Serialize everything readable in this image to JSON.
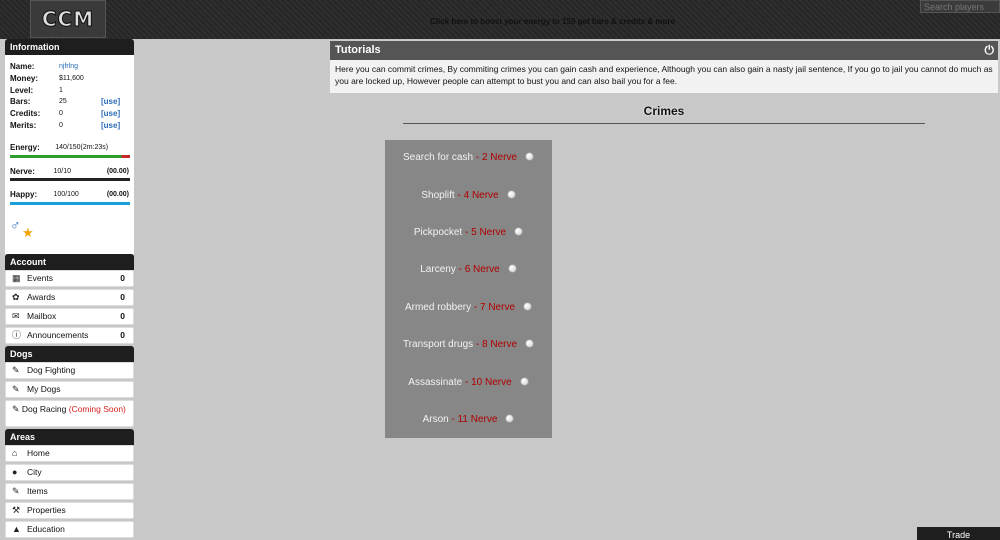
{
  "header": {
    "logo": "CCM",
    "boost_link": "Click here to boost your energy to 150 get bars & credits & more",
    "search_placeholder": "Search players"
  },
  "sidebar": {
    "info_title": "Information",
    "stats": [
      {
        "label": "Name:",
        "value": "njfrlng",
        "action": ""
      },
      {
        "label": "Money:",
        "value": "$11,600",
        "action": ""
      },
      {
        "label": "Level:",
        "value": "1",
        "action": ""
      },
      {
        "label": "Bars:",
        "value": "25",
        "action": "[use]"
      },
      {
        "label": "Credits:",
        "value": "0",
        "action": "[use]"
      },
      {
        "label": "Merits:",
        "value": "0",
        "action": "[use]"
      }
    ],
    "meters": [
      {
        "label": "Energy:",
        "value": "140/150(2m:23s)",
        "timer": "",
        "fill": 0.933,
        "color": "#2e9c2e",
        "track": "#c62828"
      },
      {
        "label": "Nerve:",
        "value": "10/10",
        "timer": "(00.00)",
        "fill": 1.0,
        "color": "#222222",
        "track": "#222222"
      },
      {
        "label": "Happy:",
        "value": "100/100",
        "timer": "(00.00)",
        "fill": 1.0,
        "color": "#1aa0d8",
        "track": "#1aa0d8"
      }
    ],
    "account_title": "Account",
    "account_items": [
      {
        "label": "Events",
        "count": "0",
        "icon": "calendar-icon"
      },
      {
        "label": "Awards",
        "count": "0",
        "icon": "paw-icon"
      },
      {
        "label": "Mailbox",
        "count": "0",
        "icon": "mail-icon"
      },
      {
        "label": "Announcements",
        "count": "0",
        "icon": "info-icon"
      }
    ],
    "dogs_title": "Dogs",
    "dogs_items": [
      {
        "label": "Dog Fighting"
      },
      {
        "label": "My Dogs"
      },
      {
        "label": "Dog Racing",
        "note": "(Coming Soon)"
      }
    ],
    "areas_title": "Areas",
    "areas_items": [
      {
        "label": "Home",
        "icon": "home-icon"
      },
      {
        "label": "City",
        "icon": "pin-icon"
      },
      {
        "label": "Items",
        "icon": "pencil-icon"
      },
      {
        "label": "Properties",
        "icon": "wrench-icon"
      },
      {
        "label": "Education",
        "icon": "graduation-icon"
      }
    ]
  },
  "tutorials": {
    "title": "Tutorials",
    "text": "Here you can commit crimes, By commiting crimes you can gain cash and experience, Although you can also gain a nasty jail sentence, If you go to jail you cannot do much as you are locked up, However people can attempt to bust you and can also bail you for a fee."
  },
  "crimes": {
    "title": "Crimes",
    "list": [
      {
        "name": "Search for cash",
        "nerve": " - 2 Nerve"
      },
      {
        "name": "Shoplift",
        "nerve": " - 4 Nerve"
      },
      {
        "name": "Pickpocket",
        "nerve": " - 5 Nerve"
      },
      {
        "name": "Larceny",
        "nerve": " - 6 Nerve"
      },
      {
        "name": "Armed robbery",
        "nerve": " - 7 Nerve"
      },
      {
        "name": "Transport drugs",
        "nerve": " - 8 Nerve"
      },
      {
        "name": "Assassinate",
        "nerve": " - 10 Nerve"
      },
      {
        "name": "Arson",
        "nerve": " - 11 Nerve"
      }
    ]
  },
  "footer": {
    "trade_label": "Trade"
  }
}
